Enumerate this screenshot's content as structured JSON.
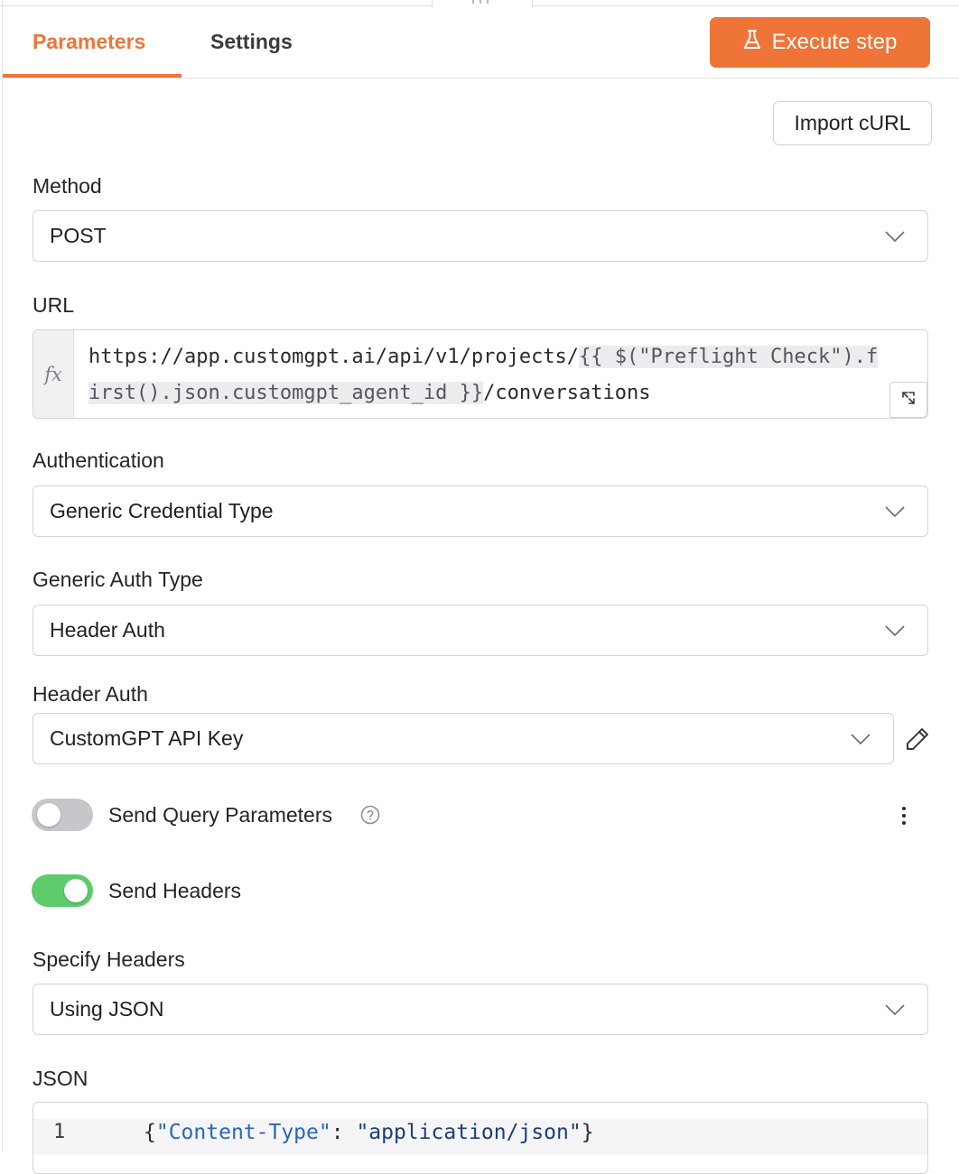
{
  "tabs": [
    {
      "label": "Parameters",
      "active": true
    },
    {
      "label": "Settings",
      "active": false
    }
  ],
  "execute_button": {
    "label": "Execute step",
    "icon": "flask-icon"
  },
  "import_button": {
    "label": "Import cURL"
  },
  "method": {
    "label": "Method",
    "value": "POST"
  },
  "url": {
    "label": "URL",
    "fx": "fx",
    "prefix": "https://app.customgpt.ai/api/v1/projects/",
    "expression": "{{ $(\"Preflight Check\").first().json.customgpt_agent_id }}",
    "suffix": "/conversations"
  },
  "authentication": {
    "label": "Authentication",
    "value": "Generic Credential Type"
  },
  "generic_auth_type": {
    "label": "Generic Auth Type",
    "value": "Header Auth"
  },
  "header_auth": {
    "label": "Header Auth",
    "value": "CustomGPT API Key"
  },
  "send_query_parameters": {
    "label": "Send Query Parameters",
    "enabled": false
  },
  "send_headers": {
    "label": "Send Headers",
    "enabled": true
  },
  "specify_headers": {
    "label": "Specify Headers",
    "value": "Using JSON"
  },
  "json": {
    "label": "JSON",
    "line_number": "1",
    "code_open": "{",
    "code_key": "\"Content-Type\"",
    "code_sep": ": ",
    "code_value": "\"application/json\"",
    "code_close": "}"
  },
  "colors": {
    "accent": "#ef7437",
    "toggle_on": "#5ecb6b",
    "toggle_off": "#c7c7cb"
  }
}
